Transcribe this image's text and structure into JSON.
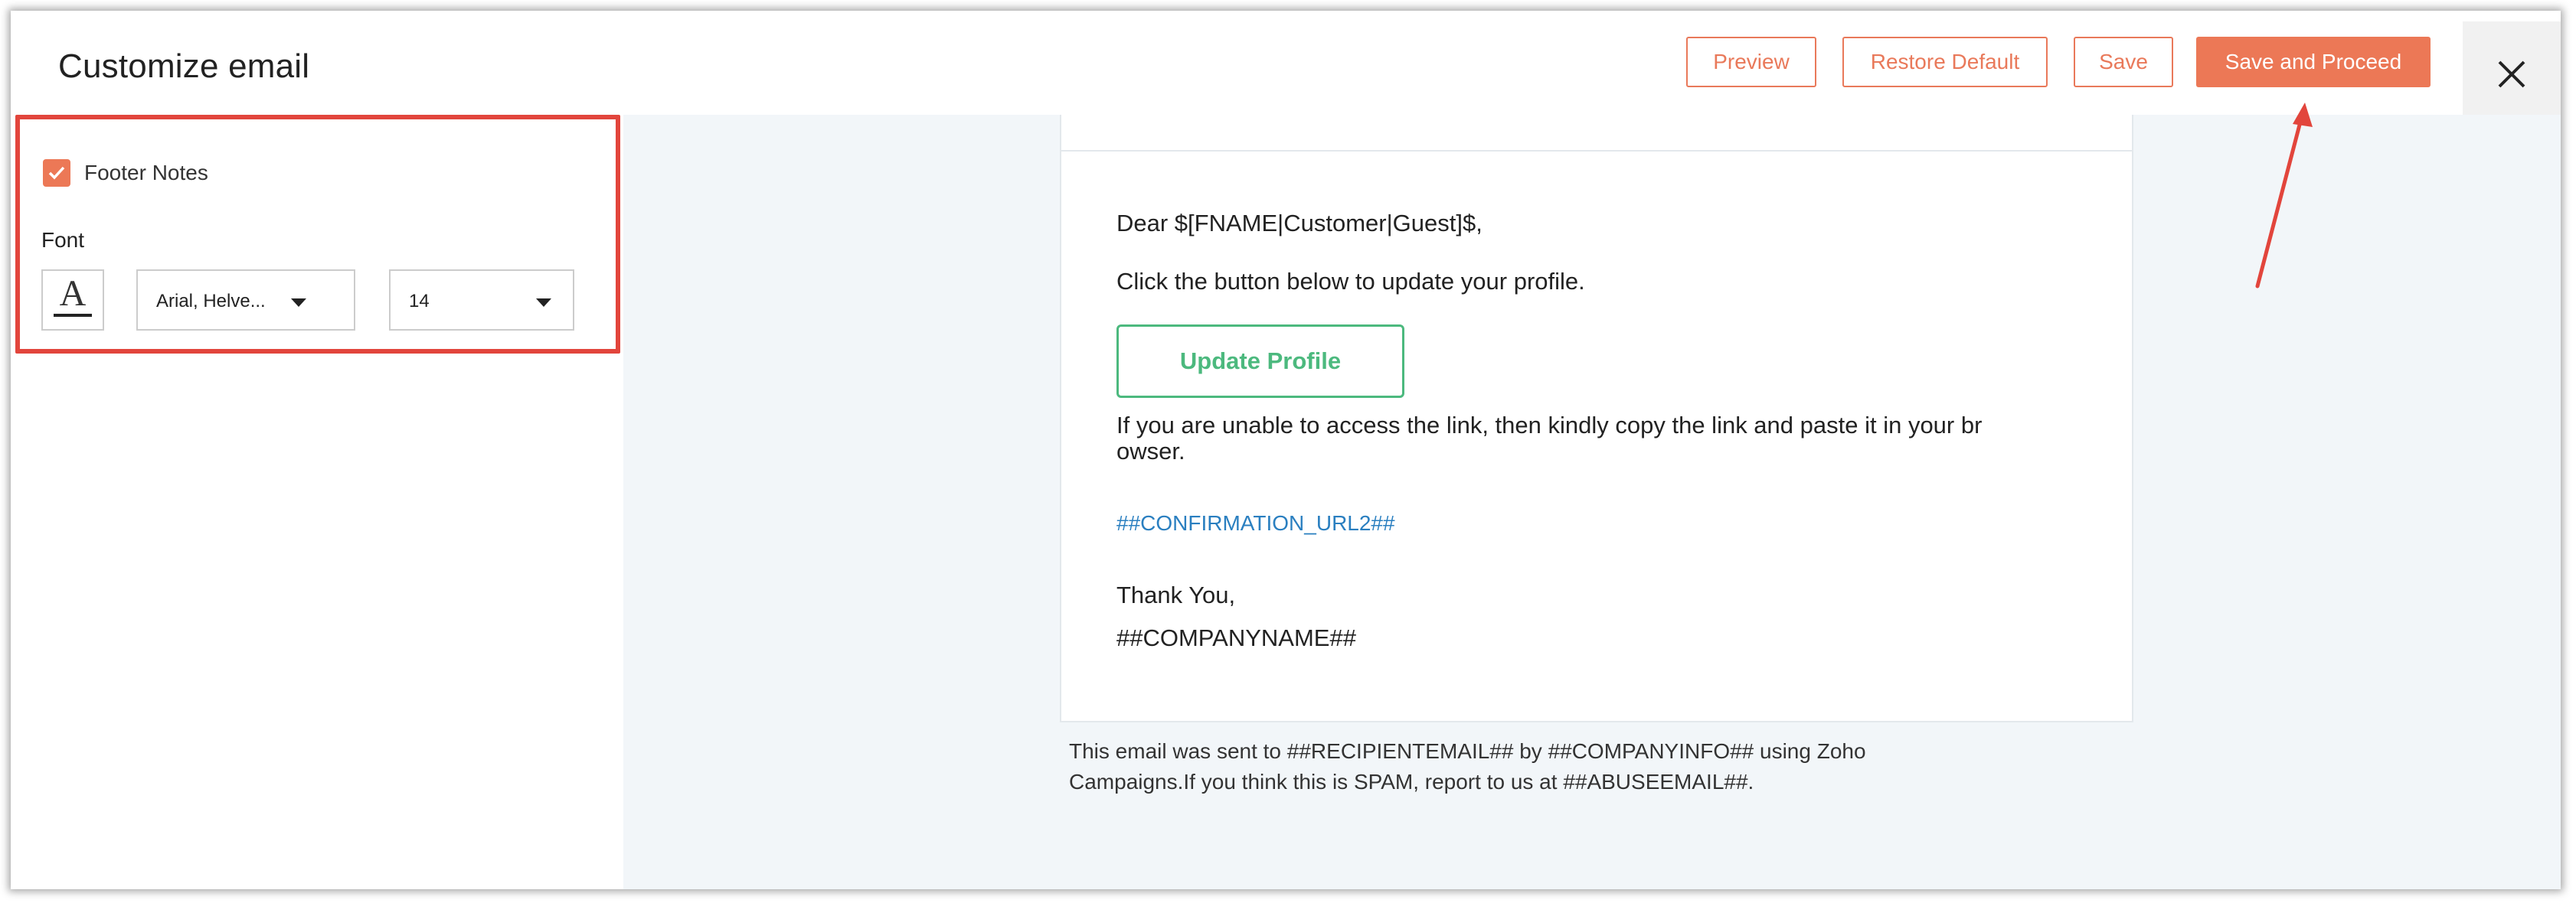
{
  "header": {
    "title": "Customize email",
    "buttons": {
      "preview": "Preview",
      "restore_default": "Restore Default",
      "save": "Save",
      "save_and_proceed": "Save and Proceed"
    },
    "close_icon": "close-icon"
  },
  "left_panel": {
    "footer_notes": {
      "label": "Footer Notes",
      "checked": true
    },
    "font": {
      "label": "Font",
      "color_icon": "font-color-icon",
      "family_value": "Arial, Helve...",
      "size_value": "14"
    }
  },
  "email": {
    "greeting": "Dear $[FNAME|Customer|Guest]$,",
    "instruction": "Click the button below to update your profile.",
    "button_label": "Update Profile",
    "fallback_line1": "If you are unable to access the link, then kindly copy the link and paste it in your br",
    "fallback_line2": "owser.",
    "confirmation_url": "##CONFIRMATION_URL2##",
    "thanks": "Thank You,",
    "company": "##COMPANYNAME##"
  },
  "footer_disclaimer": {
    "line1": "This email was sent to ##RECIPIENTEMAIL## by ##COMPANYINFO## using Zoho",
    "line2": "Campaigns.If you think this is SPAM, report to us at ##ABUSEEMAIL##."
  },
  "colors": {
    "accent": "#ec7856",
    "annotation": "#e2453c",
    "update_button": "#4cb97e",
    "link": "#2a7fc0"
  }
}
